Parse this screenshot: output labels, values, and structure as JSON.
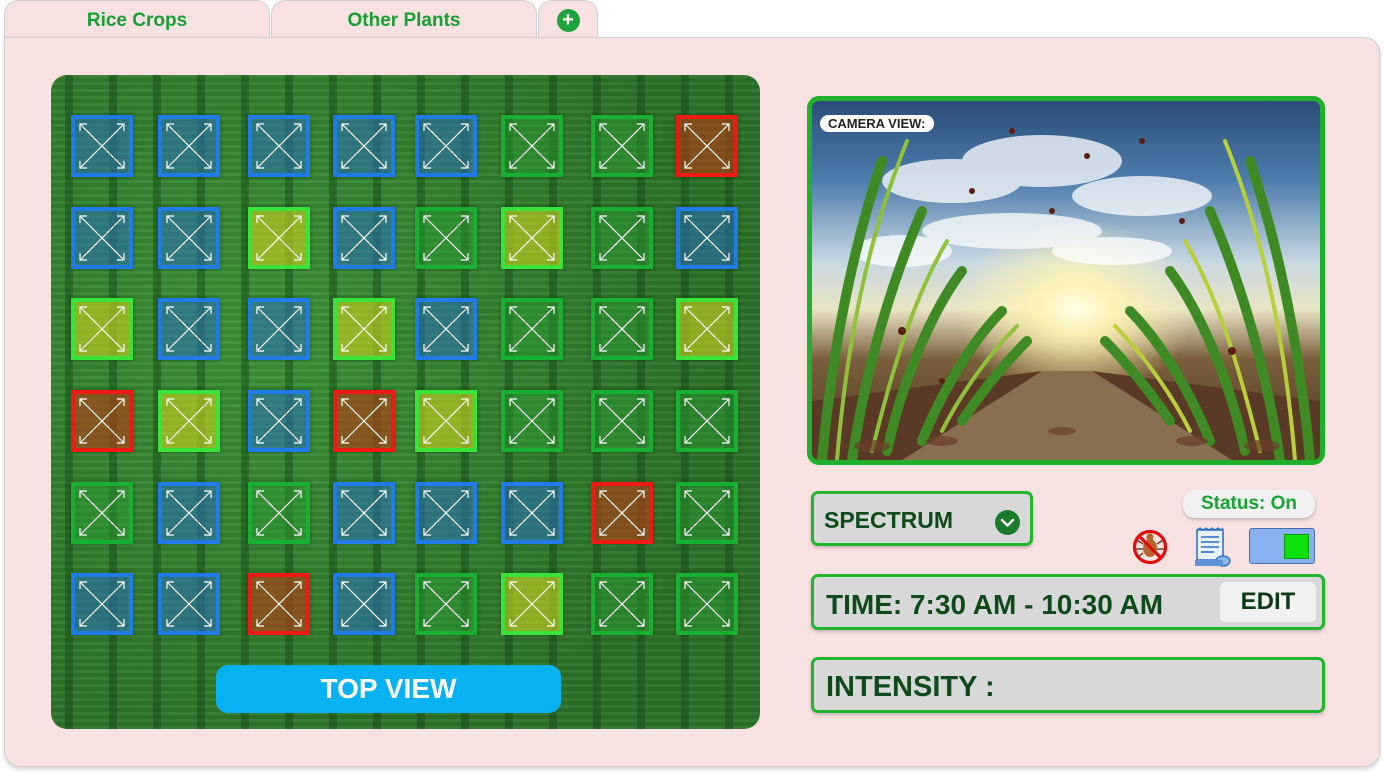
{
  "tabs": [
    {
      "label": "Rice Crops"
    },
    {
      "label": "Other Plants"
    },
    {
      "label": "+"
    }
  ],
  "field": {
    "grid": [
      [
        "blue",
        "blue",
        "blue",
        "blue",
        "blue",
        "green",
        "green",
        "red"
      ],
      [
        "blue",
        "blue",
        "yellow",
        "blue",
        "green",
        "yellow",
        "green",
        "blue"
      ],
      [
        "yellow",
        "blue",
        "blue",
        "yellow",
        "blue",
        "green",
        "green",
        "yellow"
      ],
      [
        "red",
        "yellow",
        "blue",
        "red",
        "yellow",
        "green",
        "green",
        "green"
      ],
      [
        "green",
        "blue",
        "green",
        "blue",
        "blue",
        "blue",
        "red",
        "green"
      ],
      [
        "blue",
        "blue",
        "red",
        "blue",
        "green",
        "yellow",
        "green",
        "green"
      ]
    ],
    "button_label": "TOP VIEW",
    "colors": {
      "blue": "#1f7be6",
      "green": "#17b030",
      "yellow": "#39e43a",
      "red": "#ee1b12"
    }
  },
  "camera": {
    "label": "CAMERA VIEW:"
  },
  "controls": {
    "spectrum_label": "SPECTRUM",
    "status": "Status: On",
    "icons": [
      "no-pest-icon",
      "receipt-icon",
      "toggle-switch"
    ],
    "time_label": "TIME: 7:30 AM - 10:30 AM",
    "edit_label": "EDIT",
    "intensity_label": "INTENSITY :"
  },
  "accent_color": "#22b52e"
}
